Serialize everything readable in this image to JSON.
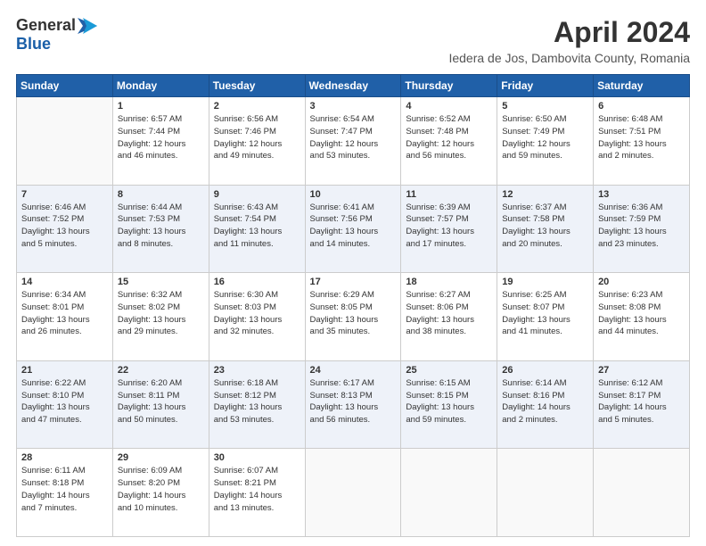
{
  "header": {
    "logo_general": "General",
    "logo_blue": "Blue",
    "title": "April 2024",
    "location": "Iedera de Jos, Dambovita County, Romania"
  },
  "weekdays": [
    "Sunday",
    "Monday",
    "Tuesday",
    "Wednesday",
    "Thursday",
    "Friday",
    "Saturday"
  ],
  "weeks": [
    [
      {
        "day": "",
        "info": ""
      },
      {
        "day": "1",
        "info": "Sunrise: 6:57 AM\nSunset: 7:44 PM\nDaylight: 12 hours\nand 46 minutes."
      },
      {
        "day": "2",
        "info": "Sunrise: 6:56 AM\nSunset: 7:46 PM\nDaylight: 12 hours\nand 49 minutes."
      },
      {
        "day": "3",
        "info": "Sunrise: 6:54 AM\nSunset: 7:47 PM\nDaylight: 12 hours\nand 53 minutes."
      },
      {
        "day": "4",
        "info": "Sunrise: 6:52 AM\nSunset: 7:48 PM\nDaylight: 12 hours\nand 56 minutes."
      },
      {
        "day": "5",
        "info": "Sunrise: 6:50 AM\nSunset: 7:49 PM\nDaylight: 12 hours\nand 59 minutes."
      },
      {
        "day": "6",
        "info": "Sunrise: 6:48 AM\nSunset: 7:51 PM\nDaylight: 13 hours\nand 2 minutes."
      }
    ],
    [
      {
        "day": "7",
        "info": "Sunrise: 6:46 AM\nSunset: 7:52 PM\nDaylight: 13 hours\nand 5 minutes."
      },
      {
        "day": "8",
        "info": "Sunrise: 6:44 AM\nSunset: 7:53 PM\nDaylight: 13 hours\nand 8 minutes."
      },
      {
        "day": "9",
        "info": "Sunrise: 6:43 AM\nSunset: 7:54 PM\nDaylight: 13 hours\nand 11 minutes."
      },
      {
        "day": "10",
        "info": "Sunrise: 6:41 AM\nSunset: 7:56 PM\nDaylight: 13 hours\nand 14 minutes."
      },
      {
        "day": "11",
        "info": "Sunrise: 6:39 AM\nSunset: 7:57 PM\nDaylight: 13 hours\nand 17 minutes."
      },
      {
        "day": "12",
        "info": "Sunrise: 6:37 AM\nSunset: 7:58 PM\nDaylight: 13 hours\nand 20 minutes."
      },
      {
        "day": "13",
        "info": "Sunrise: 6:36 AM\nSunset: 7:59 PM\nDaylight: 13 hours\nand 23 minutes."
      }
    ],
    [
      {
        "day": "14",
        "info": "Sunrise: 6:34 AM\nSunset: 8:01 PM\nDaylight: 13 hours\nand 26 minutes."
      },
      {
        "day": "15",
        "info": "Sunrise: 6:32 AM\nSunset: 8:02 PM\nDaylight: 13 hours\nand 29 minutes."
      },
      {
        "day": "16",
        "info": "Sunrise: 6:30 AM\nSunset: 8:03 PM\nDaylight: 13 hours\nand 32 minutes."
      },
      {
        "day": "17",
        "info": "Sunrise: 6:29 AM\nSunset: 8:05 PM\nDaylight: 13 hours\nand 35 minutes."
      },
      {
        "day": "18",
        "info": "Sunrise: 6:27 AM\nSunset: 8:06 PM\nDaylight: 13 hours\nand 38 minutes."
      },
      {
        "day": "19",
        "info": "Sunrise: 6:25 AM\nSunset: 8:07 PM\nDaylight: 13 hours\nand 41 minutes."
      },
      {
        "day": "20",
        "info": "Sunrise: 6:23 AM\nSunset: 8:08 PM\nDaylight: 13 hours\nand 44 minutes."
      }
    ],
    [
      {
        "day": "21",
        "info": "Sunrise: 6:22 AM\nSunset: 8:10 PM\nDaylight: 13 hours\nand 47 minutes."
      },
      {
        "day": "22",
        "info": "Sunrise: 6:20 AM\nSunset: 8:11 PM\nDaylight: 13 hours\nand 50 minutes."
      },
      {
        "day": "23",
        "info": "Sunrise: 6:18 AM\nSunset: 8:12 PM\nDaylight: 13 hours\nand 53 minutes."
      },
      {
        "day": "24",
        "info": "Sunrise: 6:17 AM\nSunset: 8:13 PM\nDaylight: 13 hours\nand 56 minutes."
      },
      {
        "day": "25",
        "info": "Sunrise: 6:15 AM\nSunset: 8:15 PM\nDaylight: 13 hours\nand 59 minutes."
      },
      {
        "day": "26",
        "info": "Sunrise: 6:14 AM\nSunset: 8:16 PM\nDaylight: 14 hours\nand 2 minutes."
      },
      {
        "day": "27",
        "info": "Sunrise: 6:12 AM\nSunset: 8:17 PM\nDaylight: 14 hours\nand 5 minutes."
      }
    ],
    [
      {
        "day": "28",
        "info": "Sunrise: 6:11 AM\nSunset: 8:18 PM\nDaylight: 14 hours\nand 7 minutes."
      },
      {
        "day": "29",
        "info": "Sunrise: 6:09 AM\nSunset: 8:20 PM\nDaylight: 14 hours\nand 10 minutes."
      },
      {
        "day": "30",
        "info": "Sunrise: 6:07 AM\nSunset: 8:21 PM\nDaylight: 14 hours\nand 13 minutes."
      },
      {
        "day": "",
        "info": ""
      },
      {
        "day": "",
        "info": ""
      },
      {
        "day": "",
        "info": ""
      },
      {
        "day": "",
        "info": ""
      }
    ]
  ]
}
